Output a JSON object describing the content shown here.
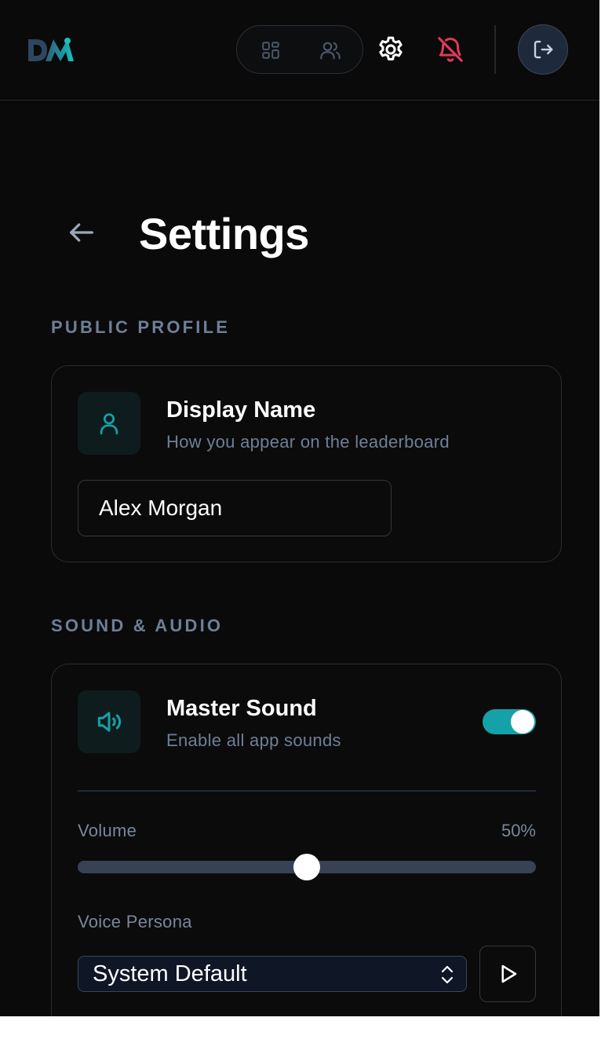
{
  "header": {
    "logo_text": "DM",
    "nav": [
      {
        "icon": "grid-icon"
      },
      {
        "icon": "users-icon"
      }
    ],
    "settings_icon": "gear-icon",
    "notifications_icon": "bell-off-icon",
    "logout_icon": "logout-icon"
  },
  "page": {
    "title": "Settings"
  },
  "profile_section": {
    "label": "PUBLIC PROFILE",
    "display_name": {
      "title": "Display Name",
      "subtitle": "How you appear on the leaderboard",
      "value": "Alex Morgan"
    }
  },
  "sound_section": {
    "label": "SOUND & AUDIO",
    "master_sound": {
      "title": "Master Sound",
      "subtitle": "Enable all app sounds",
      "enabled": true
    },
    "volume": {
      "label": "Volume",
      "value_text": "50%",
      "value": 0.5
    },
    "voice_persona": {
      "label": "Voice Persona",
      "selected": "System Default"
    }
  },
  "colors": {
    "background": "#0a0a0b",
    "accent": "#14a2a8",
    "muted_text": "#6f7f96",
    "danger": "#e03a58"
  }
}
